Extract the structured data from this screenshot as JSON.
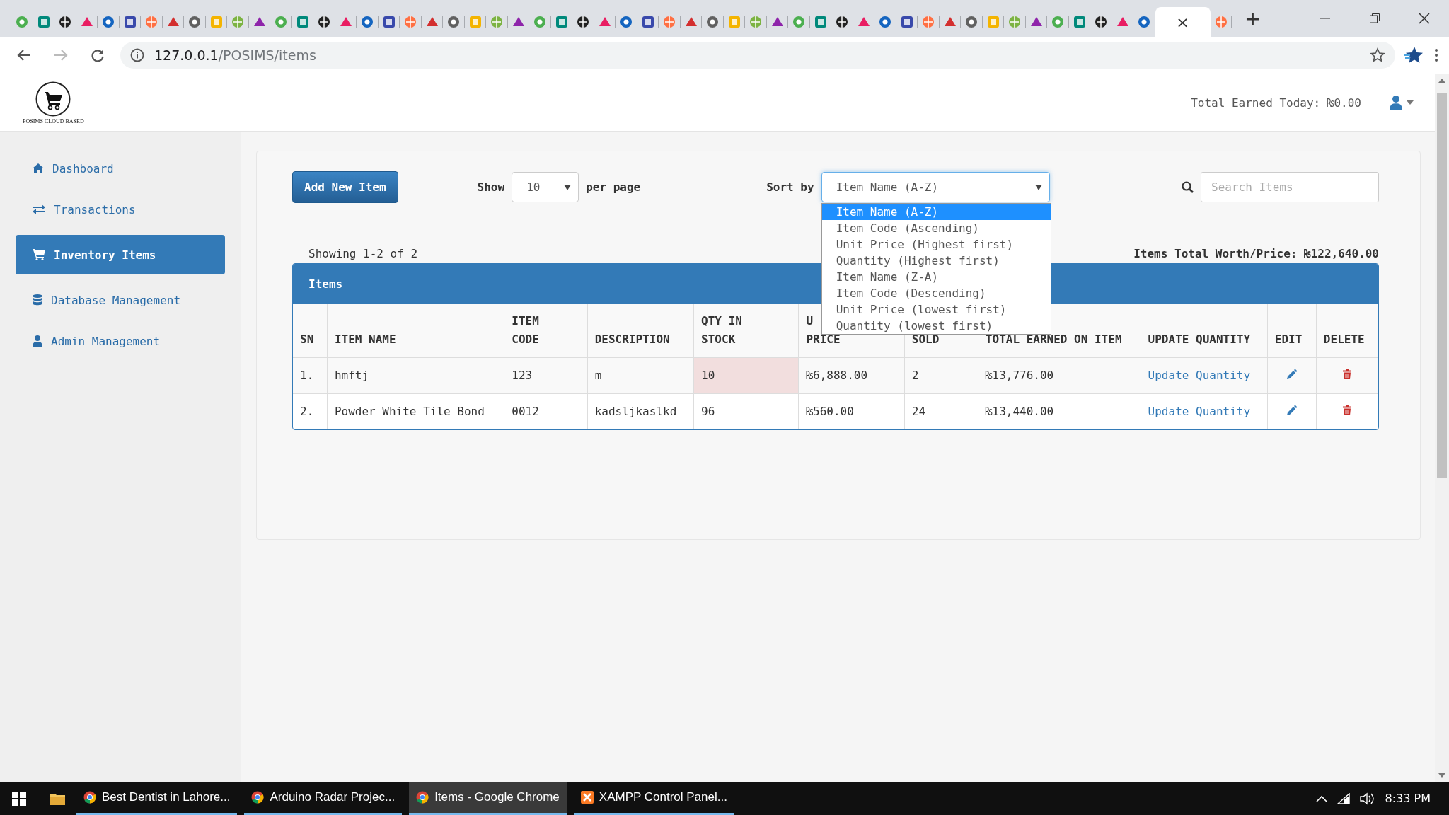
{
  "browser": {
    "tabs": [
      {
        "selected": false
      },
      {
        "selected": false
      },
      {
        "selected": false
      },
      {
        "selected": false
      },
      {
        "selected": false
      },
      {
        "selected": false
      },
      {
        "selected": false
      },
      {
        "selected": false
      },
      {
        "selected": false
      },
      {
        "selected": false
      },
      {
        "selected": false
      },
      {
        "selected": false
      },
      {
        "selected": false
      },
      {
        "selected": false
      },
      {
        "selected": false
      },
      {
        "selected": false
      },
      {
        "selected": false
      },
      {
        "selected": false
      },
      {
        "selected": false
      },
      {
        "selected": false
      },
      {
        "selected": false
      },
      {
        "selected": false
      },
      {
        "selected": false
      },
      {
        "selected": false
      },
      {
        "selected": false
      },
      {
        "selected": false
      },
      {
        "selected": false
      },
      {
        "selected": false
      },
      {
        "selected": false
      },
      {
        "selected": false
      },
      {
        "selected": false
      },
      {
        "selected": false
      },
      {
        "selected": false
      },
      {
        "selected": false
      },
      {
        "selected": false
      },
      {
        "selected": false
      },
      {
        "selected": false
      },
      {
        "selected": false
      },
      {
        "selected": false
      },
      {
        "selected": false
      },
      {
        "selected": false
      },
      {
        "selected": false
      },
      {
        "selected": false
      },
      {
        "selected": false
      },
      {
        "selected": false
      },
      {
        "selected": false
      },
      {
        "selected": false
      },
      {
        "selected": false
      },
      {
        "selected": false
      },
      {
        "selected": false
      },
      {
        "selected": false
      },
      {
        "selected": false
      },
      {
        "selected": false
      },
      {
        "selected": true,
        "close": "×"
      },
      {
        "selected": false
      }
    ],
    "new_tab": "+",
    "url": {
      "host": "127.0.0.1",
      "path": "/POSIMS/items"
    }
  },
  "header": {
    "logo_text": "POSIMS CLOUD BASED",
    "total_earned": "Total Earned Today: ₨0.00"
  },
  "sidebar": {
    "items": [
      {
        "label": "Dashboard",
        "selected": false
      },
      {
        "label": "Transactions",
        "selected": false
      },
      {
        "label": "Inventory Items",
        "selected": true
      },
      {
        "label": "Database Management",
        "selected": false
      },
      {
        "label": "Admin Management",
        "selected": false
      }
    ]
  },
  "toolbar": {
    "add_button": "Add New Item",
    "show_label": "Show",
    "per_page": {
      "value": "10"
    },
    "per_page_label": "per page",
    "sort_label": "Sort by",
    "sort": {
      "value": "Item Name (A-Z)",
      "expanded": true,
      "options": [
        {
          "label": "Item Name (A-Z)",
          "selected": true
        },
        {
          "label": "Item Code (Ascending)",
          "selected": false
        },
        {
          "label": "Unit Price (Highest first)",
          "selected": false
        },
        {
          "label": "Quantity (Highest first)",
          "selected": false
        },
        {
          "label": "Item Name (Z-A)",
          "selected": false
        },
        {
          "label": "Item Code (Descending)",
          "selected": false
        },
        {
          "label": "Unit Price (lowest first)",
          "selected": false
        },
        {
          "label": "Quantity (lowest first)",
          "selected": false
        }
      ]
    },
    "search": {
      "placeholder": "Search Items"
    }
  },
  "summary": {
    "showing": "Showing 1-2 of 2",
    "total_worth": "Items Total Worth/Price: ₨122,640.00"
  },
  "table": {
    "title": "Items",
    "columns": [
      "SN",
      "ITEM NAME",
      "ITEM\nCODE",
      "DESCRIPTION",
      "QTY IN\nSTOCK",
      "U\nPRICE",
      "SOLD",
      "TOTAL EARNED ON ITEM",
      "UPDATE QUANTITY",
      "EDIT",
      "DELETE"
    ],
    "rows": [
      {
        "cells": [
          "1.",
          "hmftj",
          "123",
          "m",
          "10",
          "₨6,888.00",
          "2",
          "₨13,776.00"
        ],
        "low_stock": true,
        "update_link": "Update Quantity"
      },
      {
        "cells": [
          "2.",
          "Powder White Tile Bond",
          "0012",
          "kadsljkaslkd",
          "96",
          "₨560.00",
          "24",
          "₨13,440.00"
        ],
        "low_stock": false,
        "update_link": "Update Quantity"
      }
    ]
  },
  "taskbar": {
    "apps": [
      {
        "label": "Best Dentist in Lahore...",
        "kind": "browser",
        "selected": false
      },
      {
        "label": "Arduino Radar Projec...",
        "kind": "browser",
        "selected": false
      },
      {
        "label": "Items - Google Chrome",
        "kind": "browser",
        "selected": true
      },
      {
        "label": "XAMPP Control Panel...",
        "kind": "panel",
        "selected": false
      }
    ],
    "clock": "8:33 PM"
  }
}
